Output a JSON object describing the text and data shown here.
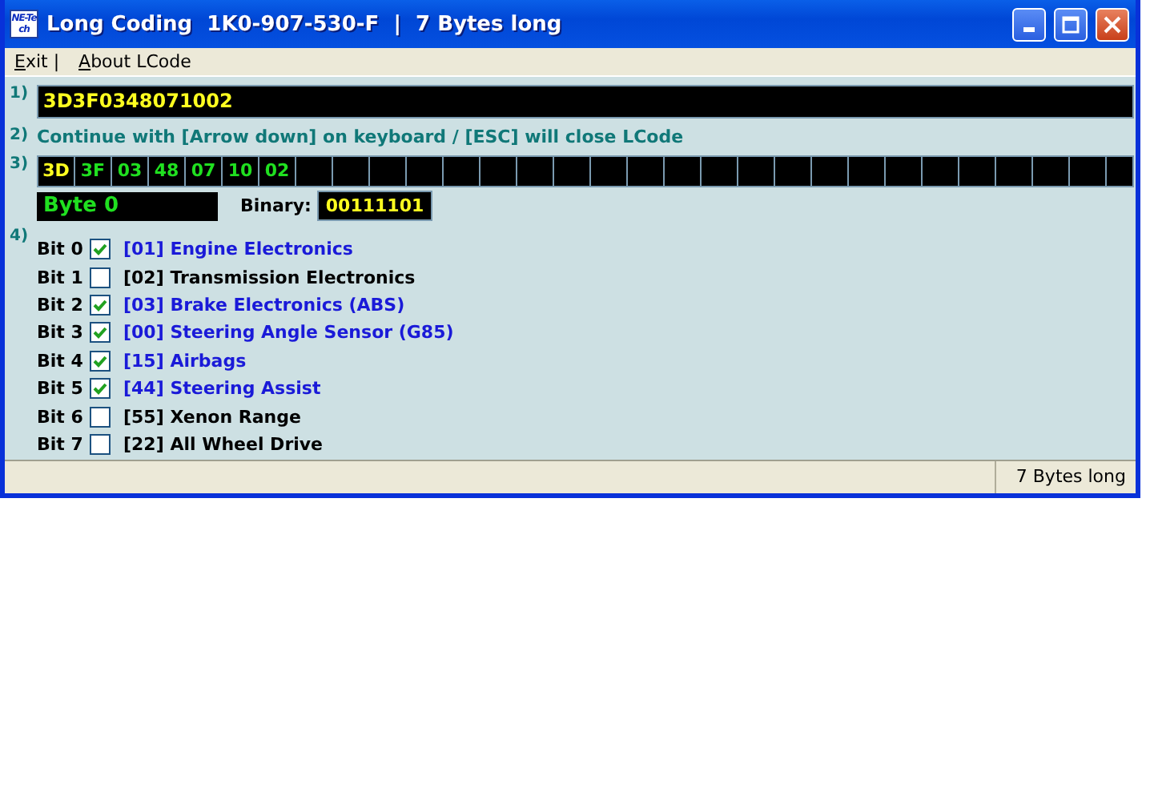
{
  "window": {
    "app_logo": "NE-Tech",
    "title": "Long Coding  1K0-907-530-F  |  7 Bytes long"
  },
  "menu": [
    {
      "label": "Exit |"
    },
    {
      "label": "About LCode"
    }
  ],
  "step_1": {
    "marker": "1)",
    "value": "3D3F0348071002"
  },
  "step_2": {
    "marker": "2)",
    "text": "Continue with [Arrow down] on keyboard / [ESC] will close LCode"
  },
  "step_3": {
    "marker": "3)",
    "bytes": [
      {
        "value": "3D",
        "selected": true
      },
      {
        "value": "3F",
        "selected": false
      },
      {
        "value": "03",
        "selected": false
      },
      {
        "value": "48",
        "selected": false
      },
      {
        "value": "07",
        "selected": false
      },
      {
        "value": "10",
        "selected": false
      },
      {
        "value": "02",
        "selected": false
      }
    ],
    "byte_label": "Byte 0",
    "binary_label": "Binary:",
    "binary_value": "00111101"
  },
  "step_4": {
    "marker": "4)",
    "bits": [
      {
        "bit": "Bit 0",
        "checked": true,
        "text": "[01] Engine Electronics"
      },
      {
        "bit": "Bit 1",
        "checked": false,
        "text": "[02] Transmission Electronics"
      },
      {
        "bit": "Bit 2",
        "checked": true,
        "text": "[03] Brake Electronics (ABS)"
      },
      {
        "bit": "Bit 3",
        "checked": true,
        "text": "[00] Steering Angle Sensor (G85)"
      },
      {
        "bit": "Bit 4",
        "checked": true,
        "text": "[15] Airbags"
      },
      {
        "bit": "Bit 5",
        "checked": true,
        "text": "[44] Steering Assist"
      },
      {
        "bit": "Bit 6",
        "checked": false,
        "text": "[55] Xenon Range"
      },
      {
        "bit": "Bit 7",
        "checked": false,
        "text": "[22] All Wheel Drive"
      }
    ]
  },
  "status_bar": "7 Bytes long"
}
